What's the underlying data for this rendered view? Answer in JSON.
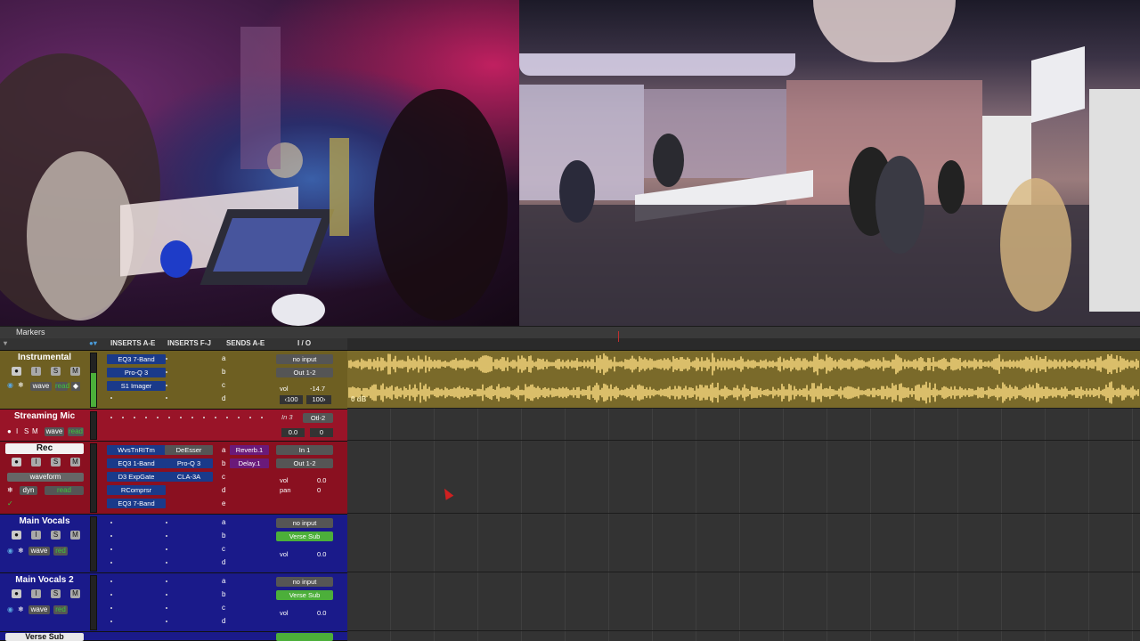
{
  "markers": {
    "label": "Markers"
  },
  "columns": {
    "inserts_ae": "INSERTS A-E",
    "inserts_fj": "INSERTS F-J",
    "sends_ae": "SENDS A-E",
    "io": "I / O"
  },
  "clip": {
    "gain": "0 dB"
  },
  "tracks": [
    {
      "name": "Instrumental",
      "buttons": [
        "I",
        "S",
        "M"
      ],
      "view": "wave",
      "mode": "read",
      "inserts_ae": [
        "EQ3 7-Band",
        "Pro-Q 3",
        "S1 Imager"
      ],
      "inserts_fj": [],
      "sends": [
        "a",
        "b",
        "c",
        "d"
      ],
      "input": "no input",
      "output": "Out 1-2",
      "vol_label": "vol",
      "vol": "-14.7",
      "pan_l": "‹100",
      "pan_r": "100›"
    },
    {
      "name": "Streaming Mic",
      "buttons": [
        "I",
        "S",
        "M"
      ],
      "view": "wave",
      "mode": "read",
      "input": "In 3",
      "output": "Otl-2",
      "vol": "0.0",
      "pan": "0"
    },
    {
      "name": "Rec",
      "buttons": [
        "I",
        "S",
        "M"
      ],
      "view": "waveform",
      "mode": "read",
      "dyn": "dyn",
      "inserts_ae": [
        "WvsTnRITm",
        "EQ3 1-Band",
        "D3 ExpGate",
        "RComprsr",
        "EQ3 7-Band"
      ],
      "inserts_fj": [
        "DeEsser",
        "Pro-Q 3",
        "CLA-3A"
      ],
      "sends": [
        "Reverb.1",
        "Delay.1",
        "c",
        "d",
        "e"
      ],
      "send_letters": [
        "a",
        "b"
      ],
      "input": "In 1",
      "output": "Out 1-2",
      "vol_label": "vol",
      "vol": "0.0",
      "pan_label": "pan",
      "pan": "0"
    },
    {
      "name": "Main Vocals",
      "buttons": [
        "I",
        "S",
        "M"
      ],
      "view": "wave",
      "mode": "red",
      "sends": [
        "a",
        "b",
        "c",
        "d"
      ],
      "input": "no input",
      "output": "Verse Sub",
      "vol_label": "vol",
      "vol": "0.0"
    },
    {
      "name": "Main Vocals 2",
      "buttons": [
        "I",
        "S",
        "M"
      ],
      "view": "wave",
      "mode": "red",
      "sends": [
        "a",
        "b",
        "c",
        "d"
      ],
      "input": "no input",
      "output": "Verse Sub",
      "vol_label": "vol",
      "vol": "0.0"
    },
    {
      "name": "Verse Sub"
    }
  ],
  "colors": {
    "instrumental": "#7a6a28",
    "streaming": "#a01428",
    "rec": "#8a1020",
    "vocals": "#1a1a8a",
    "waveform": "#f2d47a",
    "green_io": "#4caf3a"
  }
}
